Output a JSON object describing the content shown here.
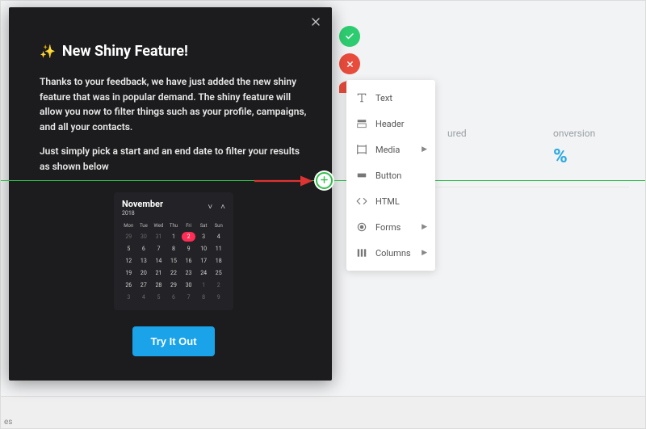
{
  "modal": {
    "title": "New Shiny Feature!",
    "para1": "Thanks to your feedback, we have just added the new shiny feature that was in popular demand. The shiny feature will allow you now to filter things such as your profile, campaigns, and all your contacts.",
    "para2": "Just simply pick a start and an end date to filter your results as shown below",
    "cta": "Try It Out"
  },
  "calendar": {
    "month": "November",
    "year": "2018",
    "dow": [
      "Mon",
      "Tue",
      "Wed",
      "Thu",
      "Fri",
      "Sat",
      "Sun"
    ],
    "selected": "2",
    "cells": [
      {
        "v": "29",
        "dim": true
      },
      {
        "v": "30",
        "dim": true
      },
      {
        "v": "31",
        "dim": true
      },
      {
        "v": "1"
      },
      {
        "v": "2",
        "sel": true
      },
      {
        "v": "3"
      },
      {
        "v": "4"
      },
      {
        "v": "5"
      },
      {
        "v": "6"
      },
      {
        "v": "7"
      },
      {
        "v": "8"
      },
      {
        "v": "9"
      },
      {
        "v": "10"
      },
      {
        "v": "11"
      },
      {
        "v": "12"
      },
      {
        "v": "13"
      },
      {
        "v": "14"
      },
      {
        "v": "15"
      },
      {
        "v": "16"
      },
      {
        "v": "17"
      },
      {
        "v": "18"
      },
      {
        "v": "19"
      },
      {
        "v": "20"
      },
      {
        "v": "21"
      },
      {
        "v": "22"
      },
      {
        "v": "23"
      },
      {
        "v": "24"
      },
      {
        "v": "25"
      },
      {
        "v": "26"
      },
      {
        "v": "27"
      },
      {
        "v": "28"
      },
      {
        "v": "29"
      },
      {
        "v": "30"
      },
      {
        "v": "1",
        "dim": true
      },
      {
        "v": "2",
        "dim": true
      },
      {
        "v": "3",
        "dim": true
      },
      {
        "v": "4",
        "dim": true
      },
      {
        "v": "5",
        "dim": true
      },
      {
        "v": "6",
        "dim": true
      },
      {
        "v": "7",
        "dim": true
      },
      {
        "v": "8",
        "dim": true
      },
      {
        "v": "9",
        "dim": true
      }
    ]
  },
  "panel": {
    "items": [
      {
        "label": "Text",
        "icon": "text",
        "sub": false
      },
      {
        "label": "Header",
        "icon": "header",
        "sub": false
      },
      {
        "label": "Media",
        "icon": "media",
        "sub": true
      },
      {
        "label": "Button",
        "icon": "button",
        "sub": false
      },
      {
        "label": "HTML",
        "icon": "html",
        "sub": false
      },
      {
        "label": "Forms",
        "icon": "forms",
        "sub": true
      },
      {
        "label": "Columns",
        "icon": "columns",
        "sub": true
      }
    ]
  },
  "handle": {
    "glyph": "✚"
  },
  "bg": {
    "metric1_label": "ured",
    "metric2_label": "onversion",
    "metric2_value": "%"
  },
  "tabs": {
    "bottom": "es"
  }
}
